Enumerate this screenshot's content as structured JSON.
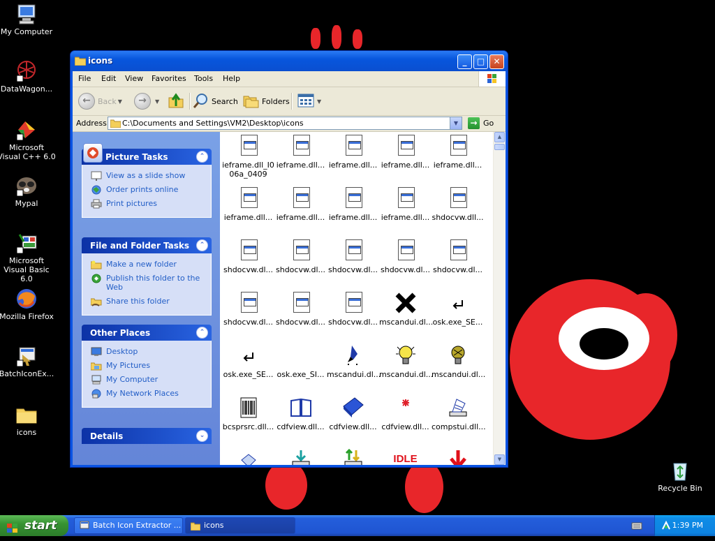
{
  "desktop": {
    "icons": [
      {
        "label": "My Computer",
        "icon": "my-computer-icon"
      },
      {
        "label": "DataWagon...",
        "icon": "datawagon-icon"
      },
      {
        "label": "Microsoft Visual C++ 6.0",
        "icon": "visual-cpp-icon"
      },
      {
        "label": "Mypal",
        "icon": "mypal-icon"
      },
      {
        "label": "Microsoft Visual Basic 6.0",
        "icon": "visual-basic-icon"
      },
      {
        "label": "Mozilla Firefox",
        "icon": "firefox-icon"
      },
      {
        "label": "BatchIconEx...",
        "icon": "batch-icon-extractor-icon"
      },
      {
        "label": "icons",
        "icon": "folder-icon"
      },
      {
        "label": "Recycle Bin",
        "icon": "recycle-bin-icon"
      }
    ]
  },
  "window": {
    "title": "icons",
    "menu": [
      "File",
      "Edit",
      "View",
      "Favorites",
      "Tools",
      "Help"
    ],
    "toolbar": {
      "back": "Back",
      "search": "Search",
      "folders": "Folders"
    },
    "address": {
      "label": "Address",
      "value": "C:\\Documents and Settings\\VM2\\Desktop\\icons",
      "go": "Go"
    }
  },
  "tasks": {
    "picture": {
      "title": "Picture Tasks",
      "links": [
        "View as a slide show",
        "Order prints online",
        "Print pictures"
      ]
    },
    "file_folder": {
      "title": "File and Folder Tasks",
      "links": [
        "Make a new folder",
        "Publish this folder to the Web",
        "Share this folder"
      ]
    },
    "other_places": {
      "title": "Other Places",
      "links": [
        "Desktop",
        "My Pictures",
        "My Computer",
        "My Network Places"
      ]
    },
    "details": {
      "title": "Details"
    }
  },
  "files": [
    {
      "name": "ieframe.dll_I0\n06a_0409",
      "icon": "dll-doc-icon"
    },
    {
      "name": "ieframe.dll...",
      "icon": "dll-doc-icon"
    },
    {
      "name": "ieframe.dll...",
      "icon": "dll-doc-icon"
    },
    {
      "name": "ieframe.dll...",
      "icon": "dll-doc-icon"
    },
    {
      "name": "ieframe.dll...",
      "icon": "dll-doc-icon"
    },
    {
      "name": "ieframe.dll...",
      "icon": "dll-doc-icon"
    },
    {
      "name": "ieframe.dll...",
      "icon": "dll-doc-icon"
    },
    {
      "name": "ieframe.dll...",
      "icon": "dll-doc-icon"
    },
    {
      "name": "ieframe.dll...",
      "icon": "dll-doc-icon"
    },
    {
      "name": "shdocvw.dll...",
      "icon": "dll-doc-icon"
    },
    {
      "name": "shdocvw.dl...",
      "icon": "dll-doc-icon"
    },
    {
      "name": "shdocvw.dl...",
      "icon": "dll-doc-icon"
    },
    {
      "name": "shdocvw.dl...",
      "icon": "dll-doc-icon"
    },
    {
      "name": "shdocvw.dl...",
      "icon": "dll-doc-icon"
    },
    {
      "name": "shdocvw.dl...",
      "icon": "dll-doc-icon"
    },
    {
      "name": "shdocvw.dl...",
      "icon": "dll-doc-icon"
    },
    {
      "name": "shdocvw.dl...",
      "icon": "dll-doc-icon"
    },
    {
      "name": "shdocvw.dl...",
      "icon": "dll-doc-icon"
    },
    {
      "name": "mscandui.dl...",
      "icon": "black-x-icon"
    },
    {
      "name": "osk.exe_SE...",
      "icon": "enter-arrow-icon"
    },
    {
      "name": "osk.exe_SE...",
      "icon": "enter-arrow-icon"
    },
    {
      "name": "osk.exe_SI...",
      "icon": "blank-icon"
    },
    {
      "name": "mscandui.dl...",
      "icon": "pen-icon"
    },
    {
      "name": "mscandui.dl...",
      "icon": "lightbulb-icon"
    },
    {
      "name": "mscandui.dl...",
      "icon": "lightbulb-dark-icon"
    },
    {
      "name": "bcsprsrc.dll...",
      "icon": "barcode-icon"
    },
    {
      "name": "cdfview.dll...",
      "icon": "open-book-icon"
    },
    {
      "name": "cdfview.dll...",
      "icon": "blue-book-icon"
    },
    {
      "name": "cdfview.dll...",
      "icon": "sparkle-icon"
    },
    {
      "name": "compstui.dll...",
      "icon": "printer-pen-icon"
    },
    {
      "name": "",
      "icon": "paper-icon"
    },
    {
      "name": "",
      "icon": "download-tray-icon"
    },
    {
      "name": "",
      "icon": "updown-tray-icon"
    },
    {
      "name": "IDLE",
      "icon": "idle-text-icon"
    },
    {
      "name": "",
      "icon": "red-down-arrow-icon"
    }
  ],
  "taskbar": {
    "start": "start",
    "tasks": [
      {
        "label": "Batch Icon Extractor ...",
        "active": false
      },
      {
        "label": "icons",
        "active": true
      }
    ],
    "clock": "1:39 PM"
  },
  "colors": {
    "xp_blue": "#0a54e3",
    "task_link": "#215dc6",
    "start_green": "#379332",
    "wallpaper_red": "#e8262a"
  }
}
